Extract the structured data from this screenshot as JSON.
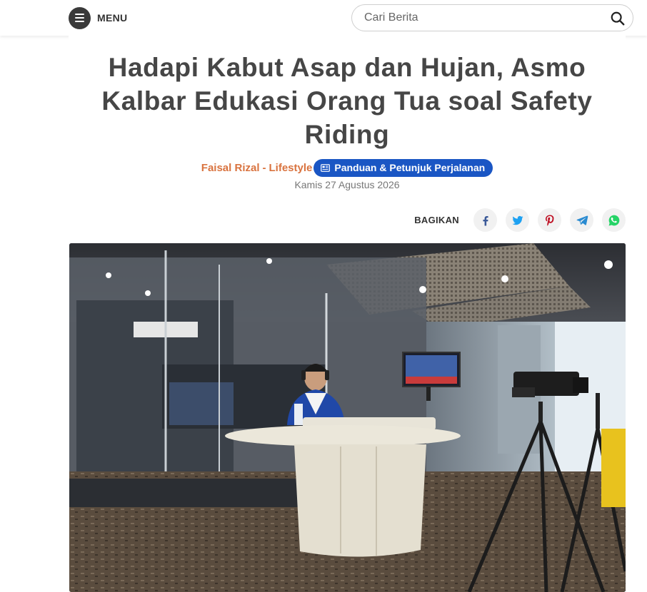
{
  "header": {
    "menu_label": "MENU",
    "search_placeholder": "Cari Berita"
  },
  "article": {
    "title": "Hadapi Kabut Asap dan Hujan, Asmo Kalbar Edukasi Orang Tua soal Safety Riding",
    "author": "Faisal Rizal",
    "separator": "-",
    "category": "Lifestyle",
    "tag": "Panduan & Petunjuk Perjalanan",
    "date": "Kamis 27 Agustus 2026"
  },
  "share": {
    "label": "BAGIKAN",
    "buttons": [
      {
        "name": "facebook-icon",
        "color": "#3b5998"
      },
      {
        "name": "twitter-icon",
        "color": "#1da1f2"
      },
      {
        "name": "pinterest-icon",
        "color": "#bd081c"
      },
      {
        "name": "telegram-icon",
        "color": "#2a8bd1"
      },
      {
        "name": "whatsapp-icon",
        "color": "#25d366"
      }
    ]
  },
  "colors": {
    "accent": "#d9733f",
    "tag_bg": "#1a56c4",
    "title": "#464646"
  }
}
